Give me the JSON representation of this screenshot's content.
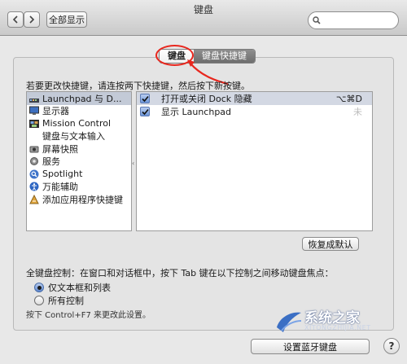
{
  "window": {
    "title": "键盘",
    "show_all_label": "全部显示"
  },
  "search": {
    "value": "",
    "placeholder": ""
  },
  "tabs": [
    {
      "label": "键盘",
      "active": true
    },
    {
      "label": "键盘快捷键",
      "active": false
    }
  ],
  "instruction": "若要更改快捷键，请连按两下快捷键，然后按下新按键。",
  "categories": [
    {
      "label": "Launchpad 与 D...",
      "icon": "launchpad-dock-icon",
      "selected": true
    },
    {
      "label": "显示器",
      "icon": "display-icon",
      "selected": false
    },
    {
      "label": "Mission Control",
      "icon": "mission-control-icon",
      "selected": false
    },
    {
      "label": "键盘与文本输入",
      "icon": "keyboard-icon",
      "selected": false
    },
    {
      "label": "屏幕快照",
      "icon": "screenshot-icon",
      "selected": false
    },
    {
      "label": "服务",
      "icon": "services-gear-icon",
      "selected": false
    },
    {
      "label": "Spotlight",
      "icon": "spotlight-icon",
      "selected": false
    },
    {
      "label": "万能辅助",
      "icon": "accessibility-icon",
      "selected": false
    },
    {
      "label": "添加应用程序快捷键",
      "icon": "app-shortcut-icon",
      "selected": false
    }
  ],
  "shortcuts": [
    {
      "checked": true,
      "label": "打开或关闭 Dock 隐藏",
      "keys": "⌥⌘D",
      "selected": true
    },
    {
      "checked": true,
      "label": "显示 Launchpad",
      "keys": "未",
      "selected": false
    }
  ],
  "restore_defaults_label": "恢复成默认",
  "full_keyboard_access": {
    "label": "全键盘控制：在窗口和对话框中，按下 Tab 键在以下控制之间移动键盘焦点：",
    "options": [
      {
        "label": "仅文本框和列表",
        "checked": true
      },
      {
        "label": "所有控制",
        "checked": false
      }
    ],
    "hint": "按下 Control+F7 来更改此设置。"
  },
  "bluetooth_button_label": "设置蓝牙键盘",
  "help_label": "?",
  "watermark": {
    "name": "系统之家",
    "url": "XITONGZHIJIA.NET"
  },
  "colors": {
    "annotation_red": "#e8271e",
    "checkbox_blue": "#6d96d9",
    "selection": "#c3cad7"
  }
}
